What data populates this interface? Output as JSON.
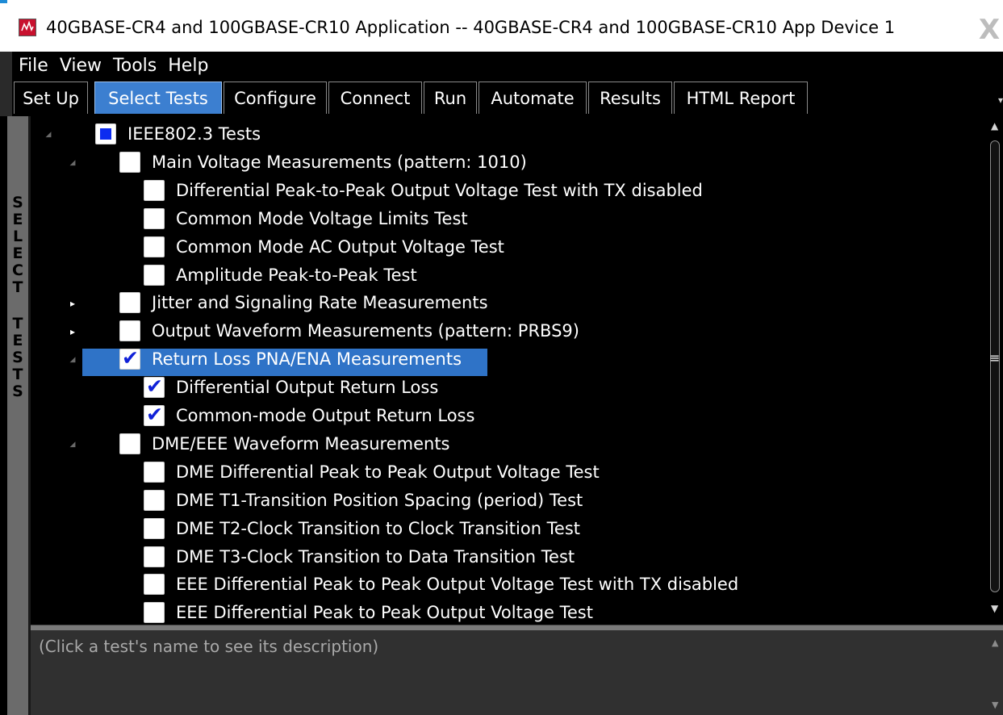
{
  "window": {
    "title": "40GBASE-CR4 and 100GBASE-CR10 Application -- 40GBASE-CR4 and 100GBASE-CR10 App Device 1",
    "close_glyph": "X"
  },
  "menu": [
    "File",
    "View",
    "Tools",
    "Help"
  ],
  "tabs": [
    {
      "label": "Set Up",
      "active": false
    },
    {
      "label": "Select Tests",
      "active": true
    },
    {
      "label": "Configure",
      "active": false
    },
    {
      "label": "Connect",
      "active": false
    },
    {
      "label": "Run",
      "active": false
    },
    {
      "label": "Automate",
      "active": false
    },
    {
      "label": "Results",
      "active": false
    },
    {
      "label": "HTML Report",
      "active": false
    }
  ],
  "side_label": "SELECT TESTS",
  "tree": [
    {
      "label": "IEEE802.3 Tests",
      "level": 0,
      "expander": "open",
      "state": "partial"
    },
    {
      "label": "Main Voltage Measurements (pattern: 1010)",
      "level": 1,
      "expander": "open",
      "state": "unchecked"
    },
    {
      "label": "Differential Peak-to-Peak Output Voltage Test with TX disabled",
      "level": 2,
      "expander": "none",
      "state": "unchecked"
    },
    {
      "label": "Common Mode Voltage Limits Test",
      "level": 2,
      "expander": "none",
      "state": "unchecked"
    },
    {
      "label": "Common Mode AC Output Voltage Test",
      "level": 2,
      "expander": "none",
      "state": "unchecked"
    },
    {
      "label": "Amplitude Peak-to-Peak Test",
      "level": 2,
      "expander": "none",
      "state": "unchecked"
    },
    {
      "label": "Jitter and Signaling Rate Measurements",
      "level": 1,
      "expander": "closed",
      "state": "unchecked"
    },
    {
      "label": "Output Waveform Measurements (pattern: PRBS9)",
      "level": 1,
      "expander": "closed",
      "state": "unchecked"
    },
    {
      "label": "Return Loss PNA/ENA Measurements",
      "level": 1,
      "expander": "open",
      "state": "checked",
      "selected": true
    },
    {
      "label": "Differential Output Return Loss",
      "level": 2,
      "expander": "none",
      "state": "checked"
    },
    {
      "label": "Common-mode Output Return Loss",
      "level": 2,
      "expander": "none",
      "state": "checked"
    },
    {
      "label": "DME/EEE Waveform Measurements",
      "level": 1,
      "expander": "open",
      "state": "unchecked"
    },
    {
      "label": "DME Differential Peak to Peak Output Voltage Test",
      "level": 2,
      "expander": "none",
      "state": "unchecked"
    },
    {
      "label": "DME T1-Transition Position Spacing (period) Test",
      "level": 2,
      "expander": "none",
      "state": "unchecked"
    },
    {
      "label": "DME T2-Clock Transition to Clock Transition Test",
      "level": 2,
      "expander": "none",
      "state": "unchecked"
    },
    {
      "label": "DME T3-Clock Transition to Data Transition Test",
      "level": 2,
      "expander": "none",
      "state": "unchecked"
    },
    {
      "label": "EEE Differential Peak to Peak Output Voltage Test with TX disabled",
      "level": 2,
      "expander": "none",
      "state": "unchecked"
    },
    {
      "label": "EEE Differential Peak to Peak Output Voltage Test",
      "level": 2,
      "expander": "none",
      "state": "unchecked"
    }
  ],
  "description": {
    "placeholder": "(Click a test's name to see its description)"
  },
  "colors": {
    "active_tab": "#3c7fd0",
    "selection": "#2f73c7",
    "check": "#1021d8",
    "partial": "#0d2cf0"
  }
}
